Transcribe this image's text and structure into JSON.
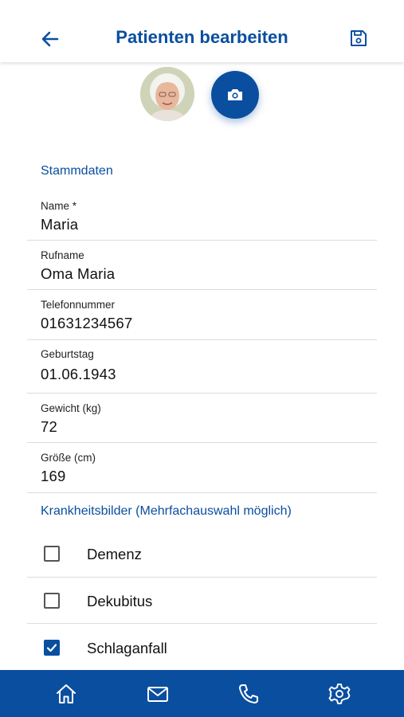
{
  "header": {
    "title": "Patienten bearbeiten",
    "back_icon": "arrow-left-icon",
    "save_icon": "floppy-disk-icon"
  },
  "avatar": {
    "icon": "patient-photo"
  },
  "camera_button": {
    "icon": "camera-icon"
  },
  "stammdaten": {
    "section_title": "Stammdaten",
    "fields": [
      {
        "label": "Name *",
        "value": "Maria"
      },
      {
        "label": "Rufname",
        "value": "Oma Maria"
      },
      {
        "label": "Telefonnummer",
        "value": "01631234567"
      },
      {
        "label": "Geburtstag",
        "value": "01.06.1943"
      },
      {
        "label": "Gewicht (kg)",
        "value": "72"
      },
      {
        "label": "Größe (cm)",
        "value": "169"
      }
    ]
  },
  "krankheitsbilder": {
    "section_title": "Krankheitsbilder (Mehrfachauswahl möglich)",
    "items": [
      {
        "label": "Demenz",
        "checked": false
      },
      {
        "label": "Dekubitus",
        "checked": false
      },
      {
        "label": "Schlaganfall",
        "checked": true
      }
    ]
  },
  "bottom_nav": {
    "items": [
      {
        "icon": "home-icon"
      },
      {
        "icon": "mail-icon"
      },
      {
        "icon": "phone-icon"
      },
      {
        "icon": "settings-icon"
      }
    ]
  },
  "colors": {
    "primary": "#0a4ea0",
    "divider": "#dcdcdc"
  }
}
